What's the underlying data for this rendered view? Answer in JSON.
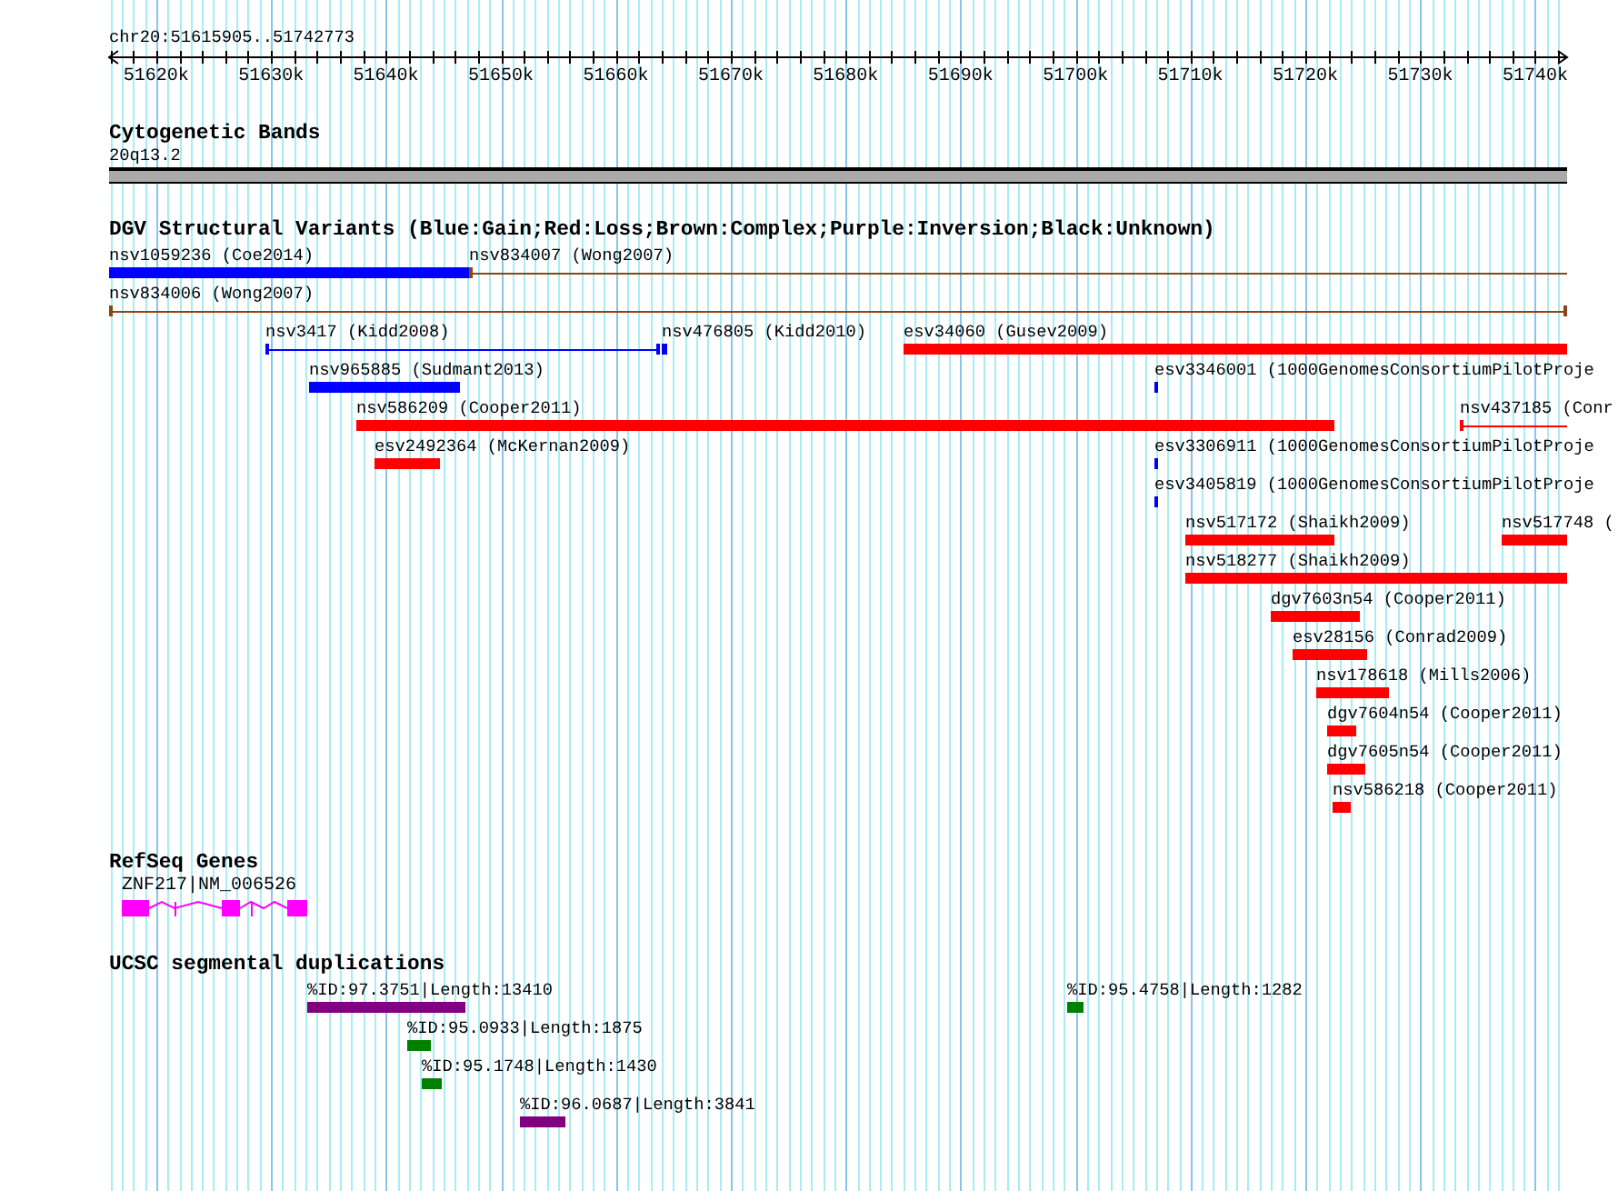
{
  "ruler": {
    "position": "chr20:51615905..51742773",
    "tick_labels": [
      "51620k",
      "51630k",
      "51640k",
      "51650k",
      "51660k",
      "51670k",
      "51680k",
      "51690k",
      "51700k",
      "51710k",
      "51720k",
      "51730k",
      "51740k"
    ]
  },
  "tracks": [
    {
      "kind": "cytoband",
      "title": "Cytogenetic Bands",
      "band_label": "20q13.2"
    },
    {
      "kind": "variants",
      "title": "DGV Structural Variants (Blue:Gain;Red:Loss;Brown:Complex;Purple:Inversion;Black:Unknown)",
      "features": [
        {
          "label": "nsv1059236 (Coe2014)",
          "color": "#0000ff",
          "kind": "bar"
        },
        {
          "label": "nsv834007 (Wong2007)",
          "color": "#8b4513",
          "kind": "span"
        },
        {
          "label": "nsv834006 (Wong2007)",
          "color": "#8b4513",
          "kind": "span"
        },
        {
          "label": "nsv3417 (Kidd2008)",
          "color": "#0000ff",
          "kind": "span"
        },
        {
          "label": "nsv476805 (Kidd2010)",
          "color": "#0000ff",
          "kind": "bar"
        },
        {
          "label": "esv34060 (Gusev2009)",
          "color": "#ff0000",
          "kind": "bar"
        },
        {
          "label": "nsv965885 (Sudmant2013)",
          "color": "#0000ff",
          "kind": "bar"
        },
        {
          "label": "esv3346001 (1000GenomesConsortiumPilotProje",
          "color": "#0000ff",
          "kind": "bar"
        },
        {
          "label": "nsv586209 (Cooper2011)",
          "color": "#ff0000",
          "kind": "bar"
        },
        {
          "label": "nsv437185 (Conr",
          "color": "#ff0000",
          "kind": "span"
        },
        {
          "label": "esv2492364 (McKernan2009)",
          "color": "#ff0000",
          "kind": "bar"
        },
        {
          "label": "esv3306911 (1000GenomesConsortiumPilotProje",
          "color": "#0000ff",
          "kind": "bar"
        },
        {
          "label": "esv3405819 (1000GenomesConsortiumPilotProje",
          "color": "#0000ff",
          "kind": "bar"
        },
        {
          "label": "nsv517172 (Shaikh2009)",
          "color": "#ff0000",
          "kind": "bar"
        },
        {
          "label": "nsv517748 (",
          "color": "#ff0000",
          "kind": "bar"
        },
        {
          "label": "nsv518277 (Shaikh2009)",
          "color": "#ff0000",
          "kind": "bar"
        },
        {
          "label": "dgv7603n54 (Cooper2011)",
          "color": "#ff0000",
          "kind": "bar"
        },
        {
          "label": "esv28156 (Conrad2009)",
          "color": "#ff0000",
          "kind": "bar"
        },
        {
          "label": "nsv178618 (Mills2006)",
          "color": "#ff0000",
          "kind": "bar"
        },
        {
          "label": "dgv7604n54 (Cooper2011)",
          "color": "#ff0000",
          "kind": "bar"
        },
        {
          "label": "dgv7605n54 (Cooper2011)",
          "color": "#ff0000",
          "kind": "bar"
        },
        {
          "label": "nsv586218 (Cooper2011)",
          "color": "#ff0000",
          "kind": "bar"
        }
      ]
    },
    {
      "kind": "genes",
      "title": "RefSeq Genes",
      "genes": [
        {
          "label": "ZNF217|NM_006526"
        }
      ]
    },
    {
      "kind": "segdups",
      "title": "UCSC segmental duplications",
      "features": [
        {
          "label": "%ID:97.3751|Length:13410",
          "color": "#800080"
        },
        {
          "label": "%ID:95.4758|Length:1282",
          "color": "#008000"
        },
        {
          "label": "%ID:95.0933|Length:1875",
          "color": "#008000"
        },
        {
          "label": "%ID:95.1748|Length:1430",
          "color": "#008000"
        },
        {
          "label": "%ID:96.0687|Length:3841",
          "color": "#800080"
        }
      ]
    }
  ]
}
